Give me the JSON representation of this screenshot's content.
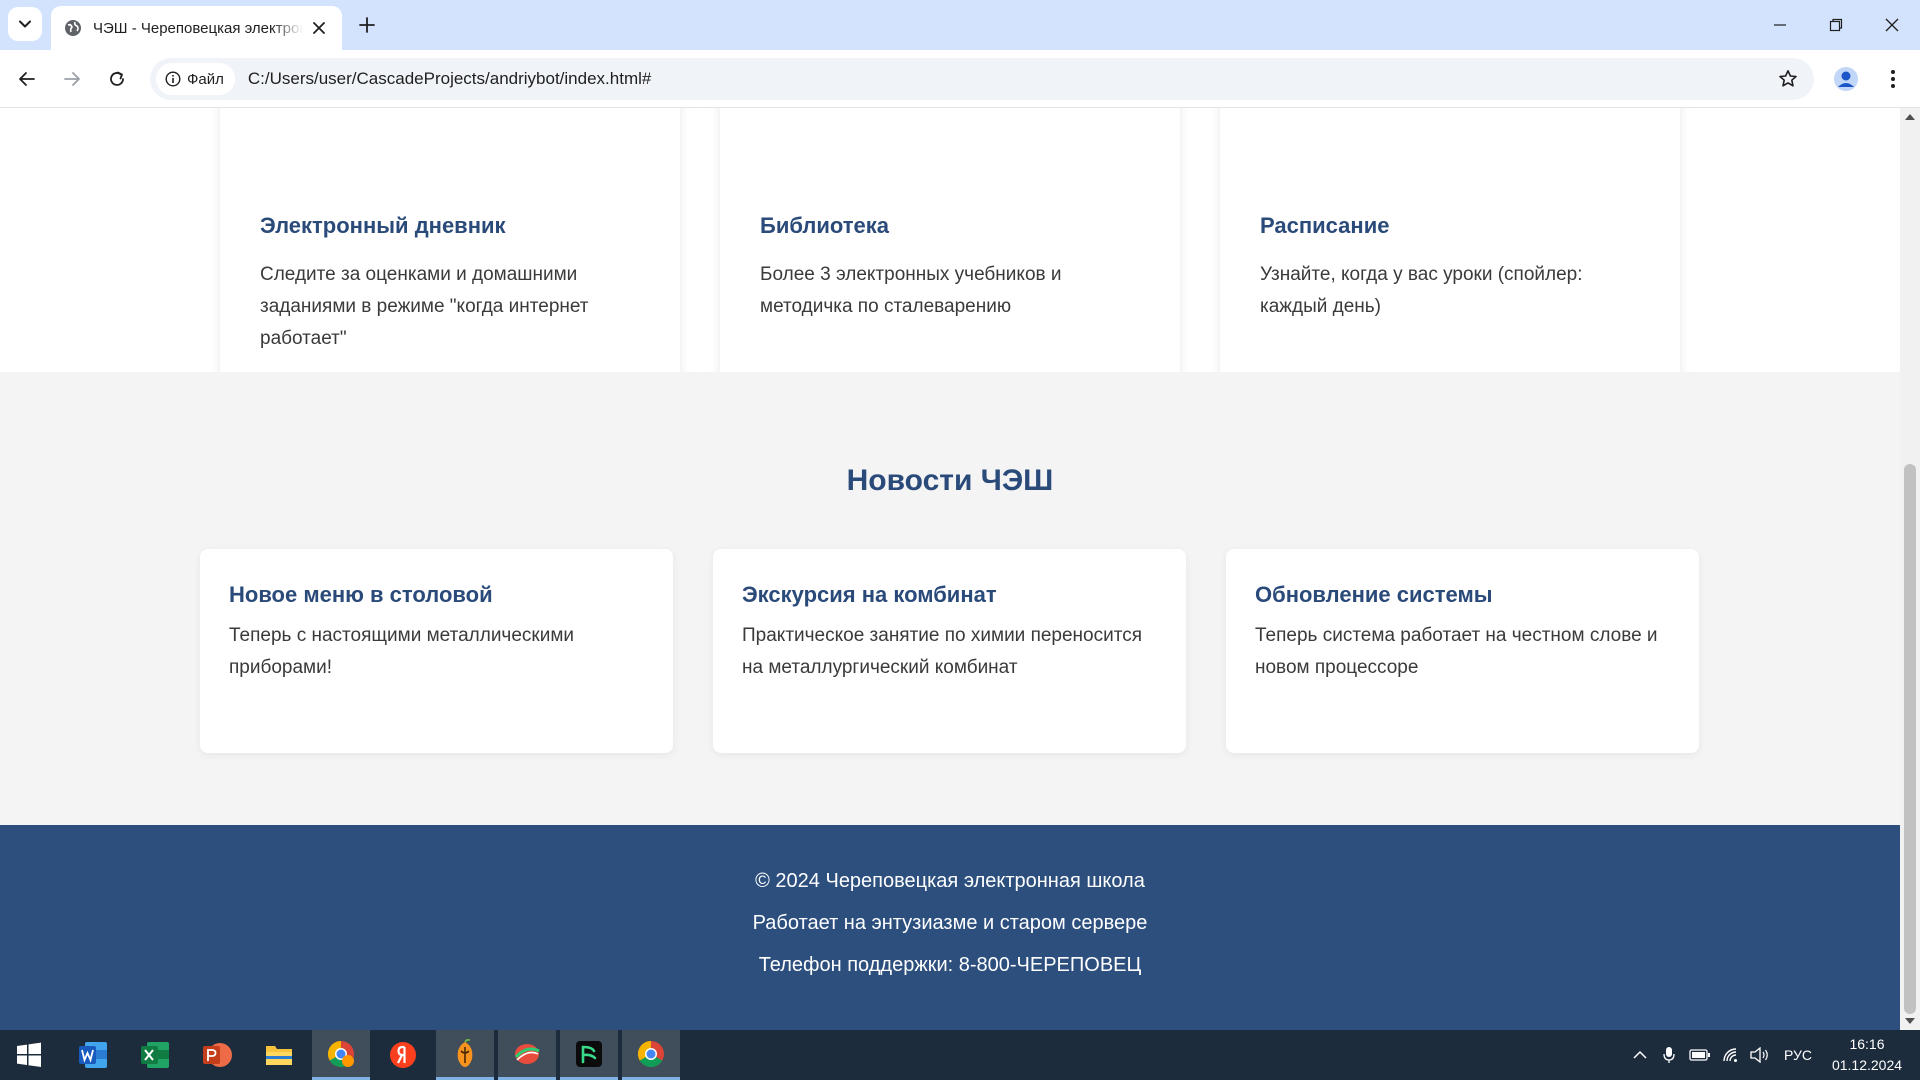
{
  "browser": {
    "tab_title": "ЧЭШ - Череповецкая электронная школа",
    "site_chip_label": "Файл",
    "url": "C:/Users/user/CascadeProjects/andriybot/index.html#"
  },
  "services": [
    {
      "title": "Электронный дневник",
      "text": "Следите за оценками и домашними заданиями в режиме \"когда интернет работает\""
    },
    {
      "title": "Библиотека",
      "text": "Более 3 электронных учебников и методичка по сталеварению"
    },
    {
      "title": "Расписание",
      "text": "Узнайте, когда у вас уроки (спойлер: каждый день)"
    }
  ],
  "news": {
    "heading": "Новости ЧЭШ",
    "items": [
      {
        "title": "Новое меню в столовой",
        "text": "Теперь с настоящими металлическими приборами!"
      },
      {
        "title": "Экскурсия на комбинат",
        "text": "Практическое занятие по химии переносится на металлургический комбинат"
      },
      {
        "title": "Обновление системы",
        "text": "Теперь система работает на честном слове и новом процессоре"
      }
    ]
  },
  "footer": {
    "copyright": "© 2024 Череповецкая электронная школа",
    "tagline": "Работает на энтузиазме и старом сервере",
    "support_phone": "Телефон поддержки: 8-800-ЧЕРЕПОВЕЦ"
  },
  "taskbar": {
    "apps": [
      "windows-start",
      "word",
      "excel",
      "powerpoint",
      "file-explorer",
      "chrome-pinned",
      "yandex-browser",
      "fl-studio",
      "ruby-app",
      "dark-app",
      "chrome"
    ],
    "language": "РУС",
    "time": "16:16",
    "date": "01.12.2024"
  },
  "colors": {
    "heading_blue": "#2a4a7a",
    "footer_bg": "#2c4f7e",
    "chrome_titlebar": "#d3e3fd",
    "taskbar_bg": "#1c2c3c"
  }
}
